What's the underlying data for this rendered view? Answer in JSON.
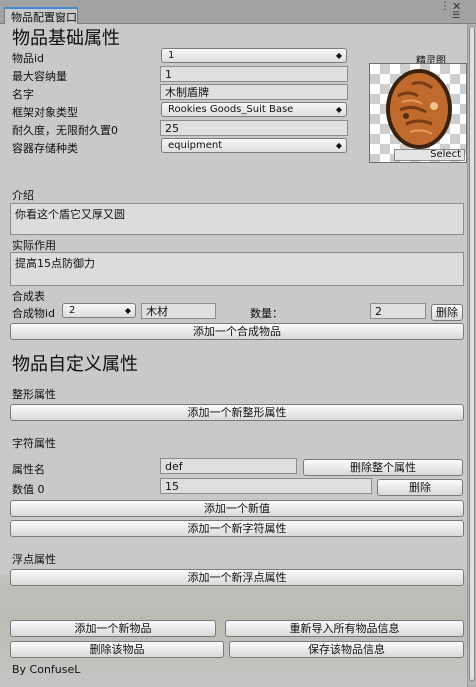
{
  "window": {
    "tab_title": "物品配置窗口"
  },
  "basic": {
    "header": "物品基础属性",
    "fields": [
      {
        "label": "物品id",
        "value": "1",
        "kind": "popup"
      },
      {
        "label": "最大容纳量",
        "value": "1",
        "kind": "text"
      },
      {
        "label": "名字",
        "value": "木制盾牌",
        "kind": "text"
      },
      {
        "label": "框架对象类型",
        "value": "Rookies Goods_Suit Base",
        "kind": "popup"
      },
      {
        "label": "耐久度，无限耐久置0",
        "value": "25",
        "kind": "text"
      },
      {
        "label": "容器存储种类",
        "value": "equipment",
        "kind": "popup"
      }
    ],
    "sprite_label": "精灵图",
    "sprite_select": "Select",
    "desc_label": "介绍",
    "desc_value": "你看这个盾它又厚又圆",
    "effect_label": "实际作用",
    "effect_value": "提高15点防御力"
  },
  "synthesis": {
    "label": "合成表",
    "item_label": "合成物id",
    "item_id": "2",
    "item_name": "木材",
    "qty_label": "数量：",
    "qty_value": "2",
    "delete_btn": "删除",
    "add_btn": "添加一个合成物品"
  },
  "custom": {
    "header": "物品自定义属性",
    "int_section": {
      "label": "整形属性",
      "add_btn": "添加一个新整形属性"
    },
    "str_section": {
      "label": "字符属性",
      "attr_label": "属性名",
      "attr_value": "def",
      "delete_attr_btn": "删除整个属性",
      "val_label": "数值 0",
      "val_value": "15",
      "delete_val_btn": "删除",
      "add_val_btn": "添加一个新值",
      "add_attr_btn": "添加一个新字符属性"
    },
    "float_section": {
      "label": "浮点属性",
      "add_btn": "添加一个新浮点属性"
    }
  },
  "footer": {
    "add_item": "添加一个新物品",
    "reimport": "重新导入所有物品信息",
    "delete_item": "删除该物品",
    "save_item": "保存该物品信息",
    "credit": "By ConfuseL"
  },
  "colors": {
    "tab_accent": "#3c8bd6",
    "panel_bg": "#c9c9c9",
    "shield_wood": "#c06a2e"
  }
}
